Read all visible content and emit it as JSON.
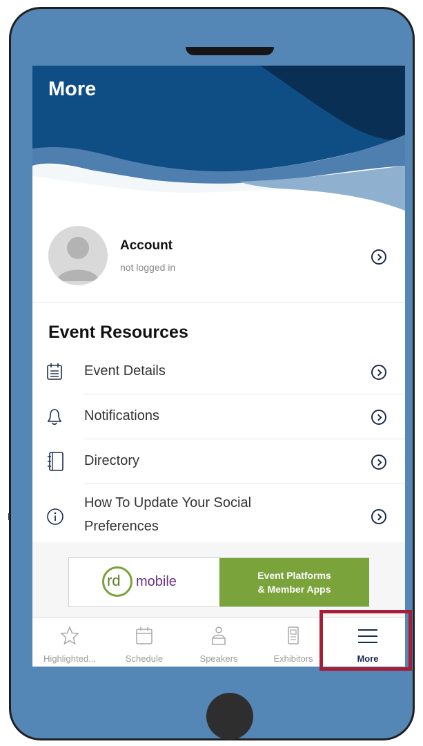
{
  "header": {
    "title": "More"
  },
  "account": {
    "title": "Account",
    "status": "not logged in"
  },
  "event_resources": {
    "title": "Event Resources",
    "items": [
      {
        "label": "Event Details",
        "icon": "calendar-icon"
      },
      {
        "label": "Notifications",
        "icon": "bell-icon"
      },
      {
        "label": "Directory",
        "icon": "book-icon"
      },
      {
        "label_line1": "How To Update Your Social",
        "label_line2": "Preferences",
        "icon": "info-icon"
      }
    ]
  },
  "banner": {
    "logo_rd": "rd",
    "logo_mobile": "mobile",
    "line1": "Event Platforms",
    "line2": "& Member Apps"
  },
  "tabs": [
    {
      "label": "Highlighted...",
      "icon": "star-icon"
    },
    {
      "label": "Schedule",
      "icon": "calendar-icon"
    },
    {
      "label": "Speakers",
      "icon": "person-icon"
    },
    {
      "label": "Exhibitors",
      "icon": "booth-icon"
    },
    {
      "label": "More",
      "icon": "menu-icon",
      "active": true
    }
  ],
  "colors": {
    "frame": "#5486b6",
    "header_dark": "#0a2f55",
    "header_mid": "#0f4d85",
    "accent_green": "#7aa33c",
    "highlight": "#a51d36"
  }
}
